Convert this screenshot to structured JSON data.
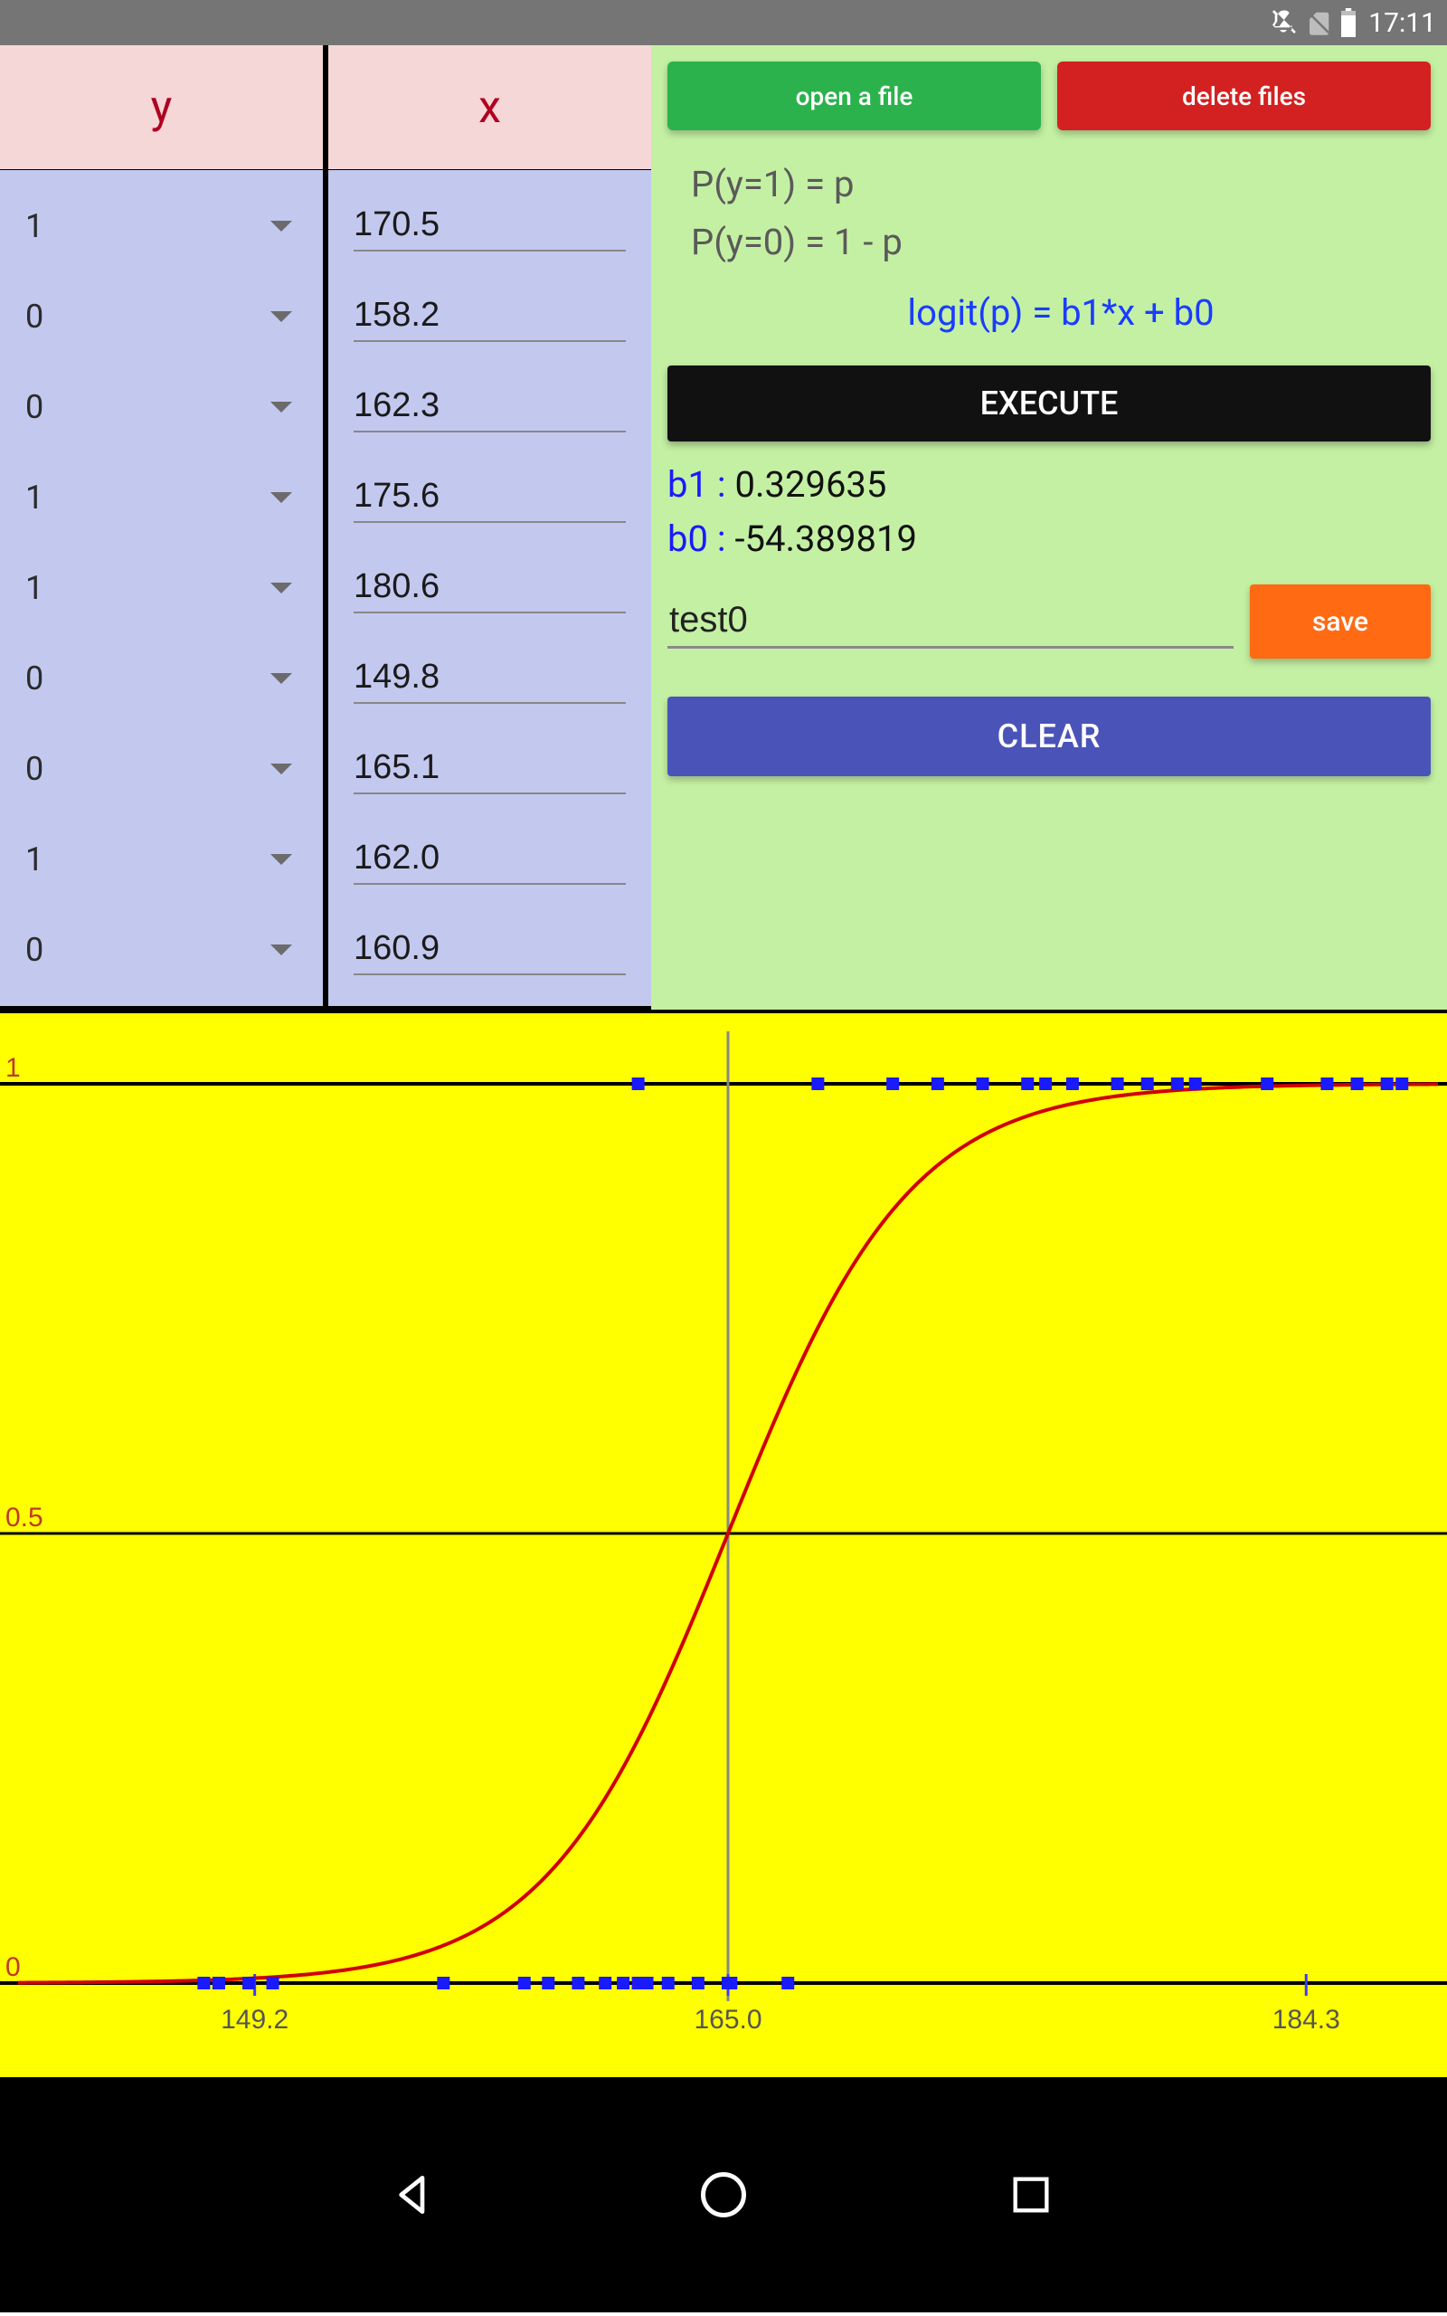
{
  "statusbar": {
    "time": "17:11"
  },
  "table": {
    "headers": {
      "y": "y",
      "x": "x"
    },
    "rows": [
      {
        "y": "1",
        "x": "170.5"
      },
      {
        "y": "0",
        "x": "158.2"
      },
      {
        "y": "0",
        "x": "162.3"
      },
      {
        "y": "1",
        "x": "175.6"
      },
      {
        "y": "1",
        "x": "180.6"
      },
      {
        "y": "0",
        "x": "149.8"
      },
      {
        "y": "0",
        "x": "165.1"
      },
      {
        "y": "1",
        "x": "162.0"
      },
      {
        "y": "0",
        "x": "160.9"
      }
    ]
  },
  "panel": {
    "open_label": "open a file",
    "delete_label": "delete files",
    "eq1": "P(y=1) = p",
    "eq2": "P(y=0) = 1 - p",
    "formula": "logit(p) = b1*x + b0",
    "execute_label": "EXECUTE",
    "b1_label": "b1 : ",
    "b1_value": "0.329635",
    "b0_label": "b0 : ",
    "b0_value": "-54.389819",
    "filename": "test0",
    "save_label": "save",
    "clear_label": "CLEAR"
  },
  "chart_data": {
    "type": "line",
    "title": "",
    "xlabel": "",
    "ylabel": "",
    "xlim": [
      141.3,
      188.7
    ],
    "ylim": [
      0,
      1
    ],
    "yticks": [
      {
        "v": 0,
        "label": "0"
      },
      {
        "v": 0.5,
        "label": "0.5"
      },
      {
        "v": 1,
        "label": "1"
      }
    ],
    "xticks": [
      {
        "v": 149.2,
        "label": "149.2"
      },
      {
        "v": 165.0,
        "label": "165.0"
      },
      {
        "v": 184.3,
        "label": "184.3"
      }
    ],
    "logistic": {
      "b1": 0.329635,
      "b0": -54.389819
    },
    "points_y1": [
      162.0,
      168.0,
      170.5,
      172.0,
      173.5,
      175.0,
      175.6,
      176.5,
      178.0,
      179.0,
      180.0,
      180.6,
      183.0,
      185.0,
      186.0,
      187.0,
      187.5
    ],
    "points_y0": [
      147.5,
      148.0,
      149.0,
      149.8,
      155.5,
      158.2,
      159.0,
      160.0,
      160.9,
      161.5,
      162.0,
      162.3,
      163.0,
      164.0,
      165.0,
      165.1,
      167.0
    ]
  }
}
